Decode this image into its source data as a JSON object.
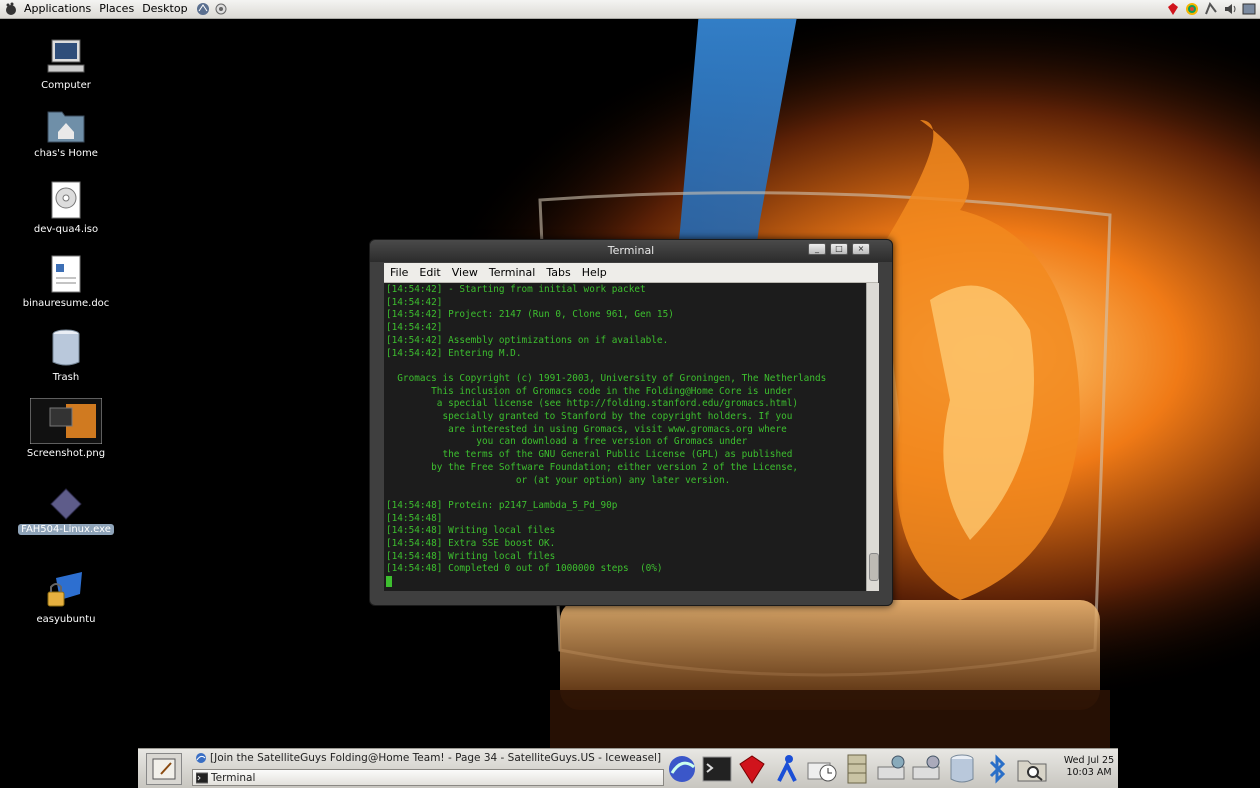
{
  "top_panel": {
    "menus": [
      "Applications",
      "Places",
      "Desktop"
    ],
    "tray_icons": [
      "ruby-icon",
      "colorful-swirl-icon",
      "network-icon",
      "volume-icon",
      "workspace-icon"
    ]
  },
  "desktop_icons": [
    {
      "label": "Computer",
      "icon": "computer-icon"
    },
    {
      "label": "chas's Home",
      "icon": "home-folder-icon"
    },
    {
      "label": "dev-qua4.iso",
      "icon": "iso-disc-icon"
    },
    {
      "label": "binauresume.doc",
      "icon": "document-icon"
    },
    {
      "label": "Trash",
      "icon": "trash-icon"
    },
    {
      "label": "Screenshot.png",
      "icon": "image-thumbnail-icon"
    },
    {
      "label": "FAH504-Linux.exe",
      "icon": "executable-icon",
      "selected": true
    },
    {
      "label": "easyubuntu",
      "icon": "locked-package-icon"
    }
  ],
  "terminal": {
    "title": "Terminal",
    "menus": [
      {
        "label": "File"
      },
      {
        "label": "Edit"
      },
      {
        "label": "View"
      },
      {
        "label": "Terminal"
      },
      {
        "label": "Tabs"
      },
      {
        "label": "Help"
      }
    ],
    "lines": [
      "[14:54:42] - Starting from initial work packet",
      "[14:54:42]",
      "[14:54:42] Project: 2147 (Run 0, Clone 961, Gen 15)",
      "[14:54:42]",
      "[14:54:42] Assembly optimizations on if available.",
      "[14:54:42] Entering M.D.",
      "",
      "  Gromacs is Copyright (c) 1991-2003, University of Groningen, The Netherlands",
      "        This inclusion of Gromacs code in the Folding@Home Core is under",
      "         a special license (see http://folding.stanford.edu/gromacs.html)",
      "          specially granted to Stanford by the copyright holders. If you",
      "           are interested in using Gromacs, visit www.gromacs.org where",
      "                you can download a free version of Gromacs under",
      "          the terms of the GNU General Public License (GPL) as published",
      "        by the Free Software Foundation; either version 2 of the License,",
      "                       or (at your option) any later version.",
      "",
      "[14:54:48] Protein: p2147_Lambda_5_Pd_90p",
      "[14:54:48]",
      "[14:54:48] Writing local files",
      "[14:54:48] Extra SSE boost OK.",
      "[14:54:48] Writing local files",
      "[14:54:48] Completed 0 out of 1000000 steps  (0%)"
    ]
  },
  "taskbar": {
    "tasks": [
      {
        "label": "[Join the SatelliteGuys Folding@Home Team! - Page 34 - SatelliteGuys.US - Iceweasel]",
        "icon": "iceweasel-icon"
      },
      {
        "label": "Terminal",
        "icon": "terminal-icon",
        "active": true
      }
    ],
    "launchers": [
      "globe-browser-icon",
      "terminal-launcher-icon",
      "ruby-gem-icon",
      "blue-figure-icon",
      "mail-clock-icon",
      "file-cabinet-icon",
      "network-drive-icon",
      "network-drive-2-icon",
      "database-icon",
      "bluetooth-icon",
      "search-folder-icon"
    ],
    "clock_date": "Wed Jul 25",
    "clock_time": "10:03 AM"
  }
}
